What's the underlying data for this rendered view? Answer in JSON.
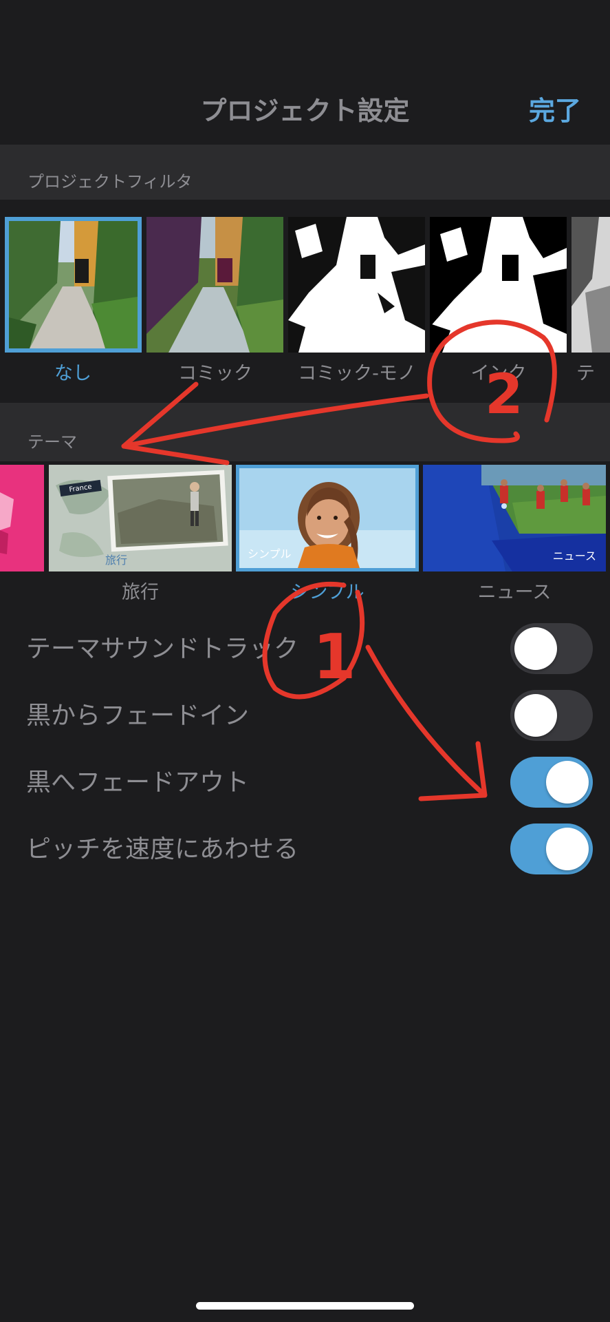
{
  "nav": {
    "title": "プロジェクト設定",
    "done_label": "完了"
  },
  "filter_section": {
    "header": "プロジェクトフィルタ",
    "filters": [
      {
        "label": "なし",
        "selected": true
      },
      {
        "label": "コミック",
        "selected": false
      },
      {
        "label": "コミック-モノ",
        "selected": false
      },
      {
        "label": "インク",
        "selected": false
      },
      {
        "label": "テ",
        "selected": false
      }
    ]
  },
  "theme_section": {
    "header": "テーマ",
    "themes": [
      {
        "label": "",
        "selected": false
      },
      {
        "label": "旅行",
        "caption": "旅行",
        "badge": "France",
        "selected": false
      },
      {
        "label": "シンプル",
        "caption": "シンプル",
        "selected": true
      },
      {
        "label": "ニュース",
        "caption": "ニュース",
        "selected": false
      }
    ]
  },
  "settings": [
    {
      "label": "テーマサウンドトラック",
      "on": false
    },
    {
      "label": "黒からフェードイン",
      "on": false
    },
    {
      "label": "黒へフェードアウト",
      "on": true
    },
    {
      "label": "ピッチを速度にあわせる",
      "on": true
    }
  ],
  "annotations": {
    "mark_1": "1",
    "mark_2": "2",
    "color": "#e5372b"
  },
  "colors": {
    "accent": "#4f9fd6",
    "background": "#1c1c1e",
    "section": "#2c2c2e",
    "text": "#8e8e93"
  }
}
